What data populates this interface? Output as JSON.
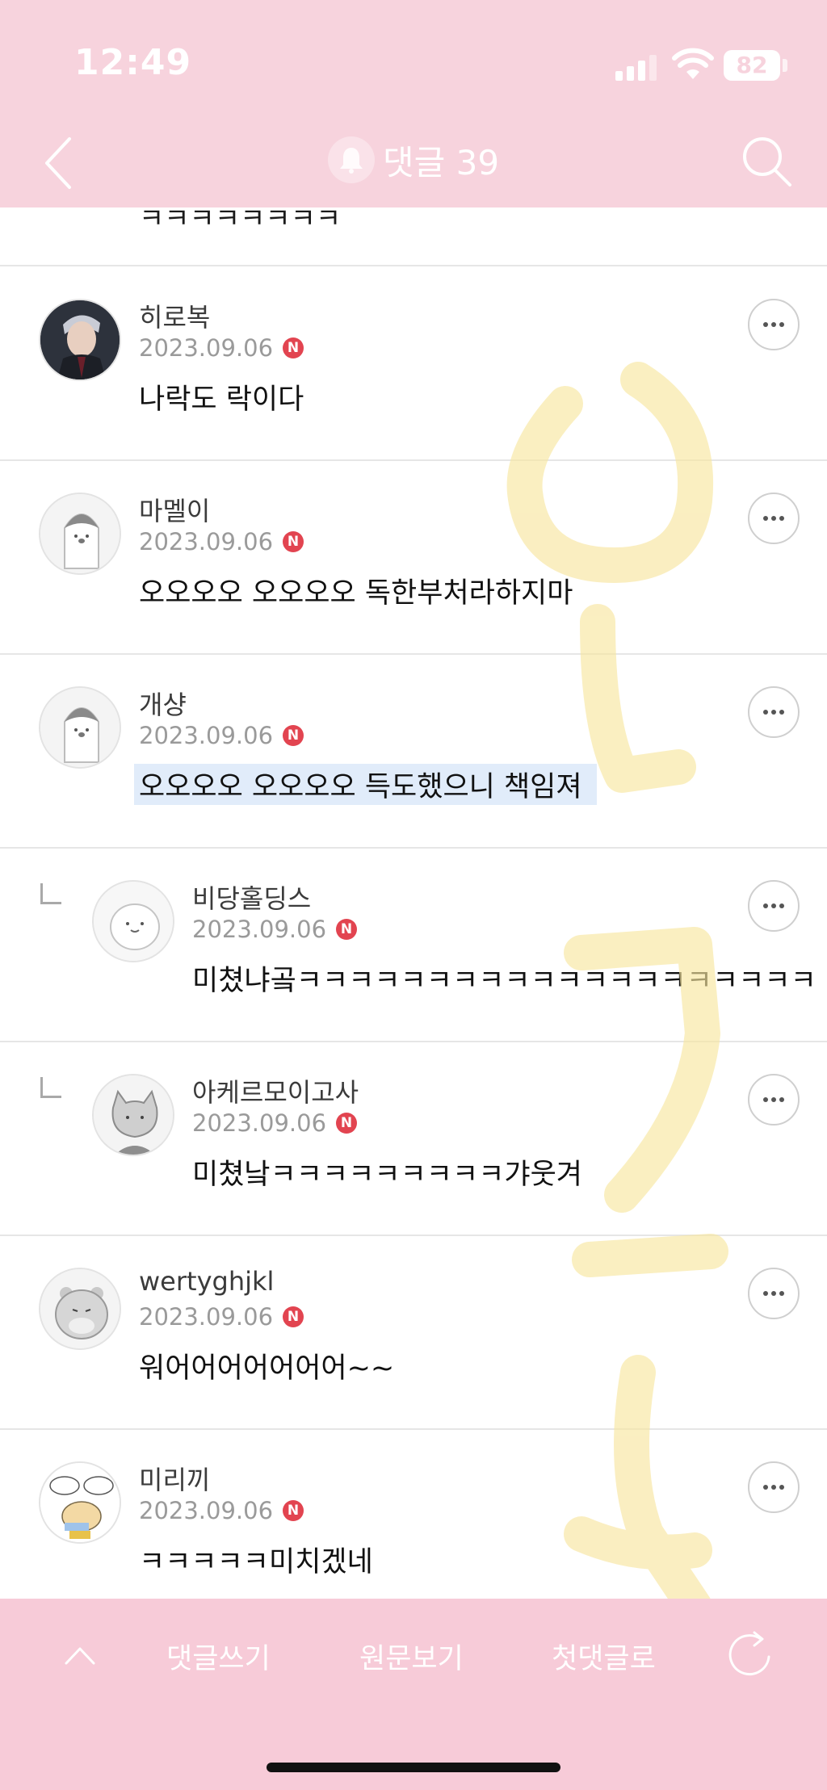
{
  "status_bar": {
    "time": "12:49",
    "battery": "82"
  },
  "nav": {
    "title": "댓글 39"
  },
  "partial_text": "ㅋㅋㅋㅋㅋㅋㅋㅋ",
  "comments": [
    {
      "name": "히로복",
      "date": "2023.09.06",
      "badge": "N",
      "text": "나락도 락이다"
    },
    {
      "name": "마멜이",
      "date": "2023.09.06",
      "badge": "N",
      "text": "오오오오 오오오오 독한부처라하지마"
    },
    {
      "name": "개샹",
      "date": "2023.09.06",
      "badge": "N",
      "text": "오오오오 오오오오 득도했으니 책임져"
    },
    {
      "name": "비당홀딩스",
      "date": "2023.09.06",
      "badge": "N",
      "text": "미쳤냐곸ㅋㅋㅋㅋㅋㅋㅋㅋㅋㅋㅋㅋㅋㅋㅋㅋㅋㅋㅋㅋ"
    },
    {
      "name": "아케르모이고사",
      "date": "2023.09.06",
      "badge": "N",
      "text": "미쳤낰ㅋㅋㅋㅋㅋㅋㅋㅋㅋ갸웃겨"
    },
    {
      "name": "wertyghjkl",
      "date": "2023.09.06",
      "badge": "N",
      "text": "워어어어어어어어~~"
    },
    {
      "name": "미리끼",
      "date": "2023.09.06",
      "badge": "N",
      "text": "ㅋㅋㅋㅋㅋ미치겠네"
    }
  ],
  "bottom_bar": {
    "write": "댓글쓰기",
    "original": "원문보기",
    "first": "첫댓글로"
  },
  "colors": {
    "header_bg": "#f7d3dd",
    "bottom_bg": "#f7cbd8",
    "badge": "#e24450",
    "watermark": "#f8e6a0"
  }
}
